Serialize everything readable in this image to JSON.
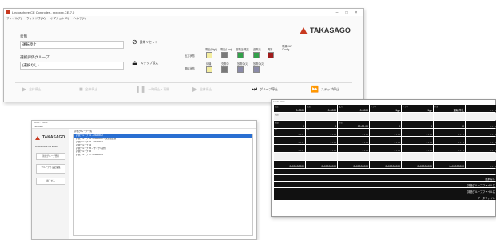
{
  "main_window": {
    "title": "Lindosphere CE Controller - xxxxxxx.CE-7.0",
    "menu": [
      "ファイル(F)",
      "ウィンドウ(W)",
      "オプション(O)",
      "ヘルプ(H)"
    ],
    "state_label": "状態",
    "state_value": "運転停止",
    "test_group_label": "選択評価グループ",
    "test_group_value": "(選択なし)",
    "error_reset_label": "異常リセット",
    "sequence_setting_label": "ステップ設定",
    "brand": "TAKASAGO",
    "status_panel": {
      "row1_label": "出力状態",
      "row2_label": "運転状態",
      "labels_row1": [
        "電圧(High)",
        "電圧(Low)",
        "過電圧/電圧",
        "過電流",
        "異常"
      ],
      "labels_row2": [
        "待機",
        "充電中",
        "放電中(1)",
        "放電中(2)"
      ],
      "extra_label": "電源OUT",
      "extra_sub": "Config",
      "colors_row1": [
        "#f4eea0",
        "#7a7a7a",
        "#33a04a",
        "#33a04a",
        "#a01c1c"
      ],
      "colors_row2": [
        "#f4eea0",
        "#7a7a7a",
        "#8a8aa8",
        "#8a8aa8"
      ]
    },
    "buttons": [
      "全体停止",
      "全体停止",
      "一時停止・再開",
      "全体停止",
      "グループ停止",
      "ステップ停止"
    ]
  },
  "app_window": {
    "title": "Lindo · xxxxx",
    "menu": "File  Help",
    "brand": "TAKASAGO",
    "sidebar_label": "Lindosphere CE Editor",
    "side_buttons": [
      "新規グループ登録",
      "グループの 設定編集",
      "終了する"
    ],
    "list_header": "評価グループ一覧",
    "list_items": [
      "評価グループ 01 ─ 20240612",
      "評価グループ 02 ─ 20240612 ─ 充放電試験",
      "評価グループ 03 ─ 20240613",
      "評価グループ 04",
      "評価グループ 05 ─ サイクル試験",
      "評価グループ 06",
      "評価グループ 07 ─ 20240614"
    ]
  },
  "data_window": {
    "title": "Lindo-Data",
    "rows": [
      [
        [
          "電圧",
          "0.0000"
        ],
        [
          "電流",
          "0.0000"
        ],
        [
          "電力",
          "0.0000"
        ],
        [
          "レンジ",
          "High"
        ],
        [
          "レンジ",
          "High"
        ],
        [
          "状態",
          "運転停止"
        ],
        [
          "",
          "- - - -"
        ]
      ],
      [
        [
          "積算",
          ""
        ],
        [
          "",
          ""
        ],
        [
          "",
          ""
        ],
        [
          "",
          ""
        ],
        [
          "",
          ""
        ],
        [
          "",
          ""
        ],
        [
          "",
          ""
        ]
      ],
      [
        [
          "経過",
          "0"
        ],
        [
          "",
          "0"
        ],
        [
          "時間",
          "00:00:00"
        ],
        [
          "",
          "0"
        ],
        [
          "",
          "0"
        ],
        [
          "",
          "0"
        ],
        [
          "",
          "- - - -"
        ]
      ],
      [
        [
          "Ah",
          "- - - -"
        ],
        [
          "Wh",
          "- - - -"
        ],
        [
          "",
          "- - - -"
        ],
        [
          "",
          "- - - -"
        ],
        [
          "",
          "- - - -"
        ],
        [
          "",
          "- - - -"
        ],
        [
          "",
          "- - - -"
        ]
      ],
      [
        [
          "",
          "- - - -"
        ],
        [
          "",
          "- - - -"
        ],
        [
          "",
          "- - - -"
        ],
        [
          "",
          "- - - -"
        ],
        [
          "",
          "- - - -"
        ],
        [
          "",
          "- - - -"
        ],
        [
          "",
          "- - - -"
        ]
      ],
      [
        [
          "",
          "- - - -"
        ],
        [
          "",
          "- - - -"
        ],
        [
          "",
          "- - - -"
        ],
        [
          "",
          "- - - -"
        ],
        [
          "",
          "- - - -"
        ],
        [
          "",
          "- - - -"
        ],
        [
          "",
          "- - - -"
        ]
      ],
      [
        [
          "",
          ""
        ],
        [
          "",
          ""
        ],
        [
          "",
          ""
        ],
        [
          "",
          ""
        ],
        [
          "",
          ""
        ],
        [
          "",
          ""
        ],
        [
          "",
          ""
        ]
      ],
      [
        [
          "",
          "0x00000000"
        ],
        [
          "",
          "0x00000000"
        ],
        [
          "",
          "0x00000000"
        ],
        [
          "",
          "0x00000000"
        ],
        [
          "",
          "0x00000000"
        ],
        [
          "",
          "0x00000000"
        ],
        [
          "",
          "- - - -"
        ]
      ]
    ],
    "wide_rows": [
      [
        "",
        ""
      ],
      [
        "",
        "選択なし"
      ],
      [
        "",
        "評価グループファイル名"
      ],
      [
        "",
        "評価グループファイル名"
      ],
      [
        "",
        "データファイル"
      ]
    ]
  }
}
